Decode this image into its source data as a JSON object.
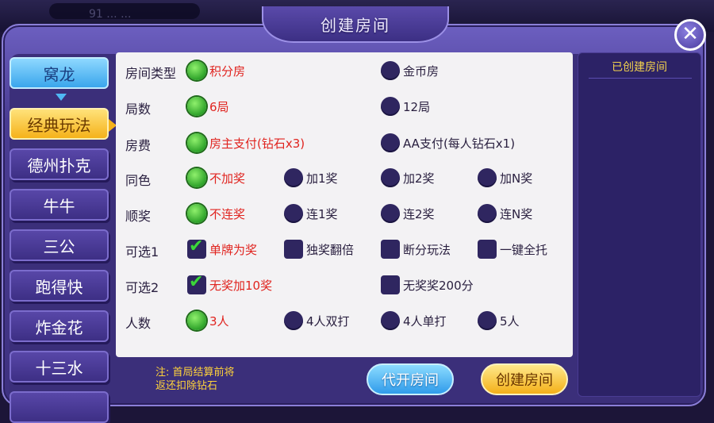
{
  "topbar": {
    "room_code": "91 ... ..."
  },
  "dialog": {
    "title": "创建房间",
    "close_label": "✕"
  },
  "tabs": [
    {
      "label": "窝龙",
      "state": "first"
    },
    {
      "label": "经典玩法",
      "state": "active"
    },
    {
      "label": "德州扑克",
      "state": "normal"
    },
    {
      "label": "牛牛",
      "state": "normal"
    },
    {
      "label": "三公",
      "state": "normal"
    },
    {
      "label": "跑得快",
      "state": "normal"
    },
    {
      "label": "炸金花",
      "state": "normal"
    },
    {
      "label": "十三水",
      "state": "normal"
    },
    {
      "label": "",
      "state": "normal"
    }
  ],
  "rows": [
    {
      "label": "房间类型",
      "options": [
        {
          "text": "积分房",
          "type": "radio",
          "selected": true
        },
        {
          "text": "金币房",
          "type": "radio",
          "selected": false
        }
      ]
    },
    {
      "label": "局数",
      "options": [
        {
          "text": "6局",
          "type": "radio",
          "selected": true
        },
        {
          "text": "12局",
          "type": "radio",
          "selected": false
        }
      ]
    },
    {
      "label": "房费",
      "options": [
        {
          "text": "房主支付(钻石x3)",
          "type": "radio",
          "selected": true
        },
        {
          "text": "AA支付(每人钻石x1)",
          "type": "radio",
          "selected": false
        }
      ]
    },
    {
      "label": "同色",
      "options": [
        {
          "text": "不加奖",
          "type": "radio",
          "selected": true
        },
        {
          "text": "加1奖",
          "type": "radio",
          "selected": false
        },
        {
          "text": "加2奖",
          "type": "radio",
          "selected": false
        },
        {
          "text": "加N奖",
          "type": "radio",
          "selected": false
        }
      ]
    },
    {
      "label": "顺奖",
      "options": [
        {
          "text": "不连奖",
          "type": "radio",
          "selected": true
        },
        {
          "text": "连1奖",
          "type": "radio",
          "selected": false
        },
        {
          "text": "连2奖",
          "type": "radio",
          "selected": false
        },
        {
          "text": "连N奖",
          "type": "radio",
          "selected": false
        }
      ]
    },
    {
      "label": "可选1",
      "options": [
        {
          "text": "单牌为奖",
          "type": "check",
          "selected": true
        },
        {
          "text": "独奖翻倍",
          "type": "check",
          "selected": false
        },
        {
          "text": "断分玩法",
          "type": "check",
          "selected": false
        },
        {
          "text": "一键全托",
          "type": "check",
          "selected": false
        }
      ]
    },
    {
      "label": "可选2",
      "options": [
        {
          "text": "无奖加10奖",
          "type": "check",
          "selected": true
        },
        {
          "text": "无奖奖200分",
          "type": "check",
          "selected": false
        }
      ]
    },
    {
      "label": "人数",
      "options": [
        {
          "text": "3人",
          "type": "radio",
          "selected": true
        },
        {
          "text": "4人双打",
          "type": "radio",
          "selected": false
        },
        {
          "text": "4人单打",
          "type": "radio",
          "selected": false
        },
        {
          "text": "5人",
          "type": "radio",
          "selected": false
        }
      ]
    }
  ],
  "sidebar": {
    "title": "已创建房间"
  },
  "footer": {
    "note_line1": "注: 首局结算前将",
    "note_line2": "返还扣除钻石",
    "proxy_button": "代开房间",
    "create_button": "创建房间"
  }
}
